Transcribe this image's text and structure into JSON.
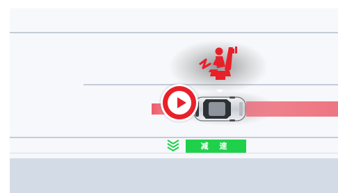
{
  "alert": {
    "warning_icon": "seat-occupant-warning-icon",
    "action_icon": "decelerate-chevrons-icon",
    "action_label": "减 速"
  },
  "player": {
    "play_icon": "play-icon"
  },
  "colors": {
    "warning_red": "#e8202a",
    "danger_zone": "#ee7581",
    "action_green": "#1fd14a",
    "road": "#f7f8fb",
    "lane_line": "#c3ccd8",
    "panel": "#d3dce6"
  }
}
